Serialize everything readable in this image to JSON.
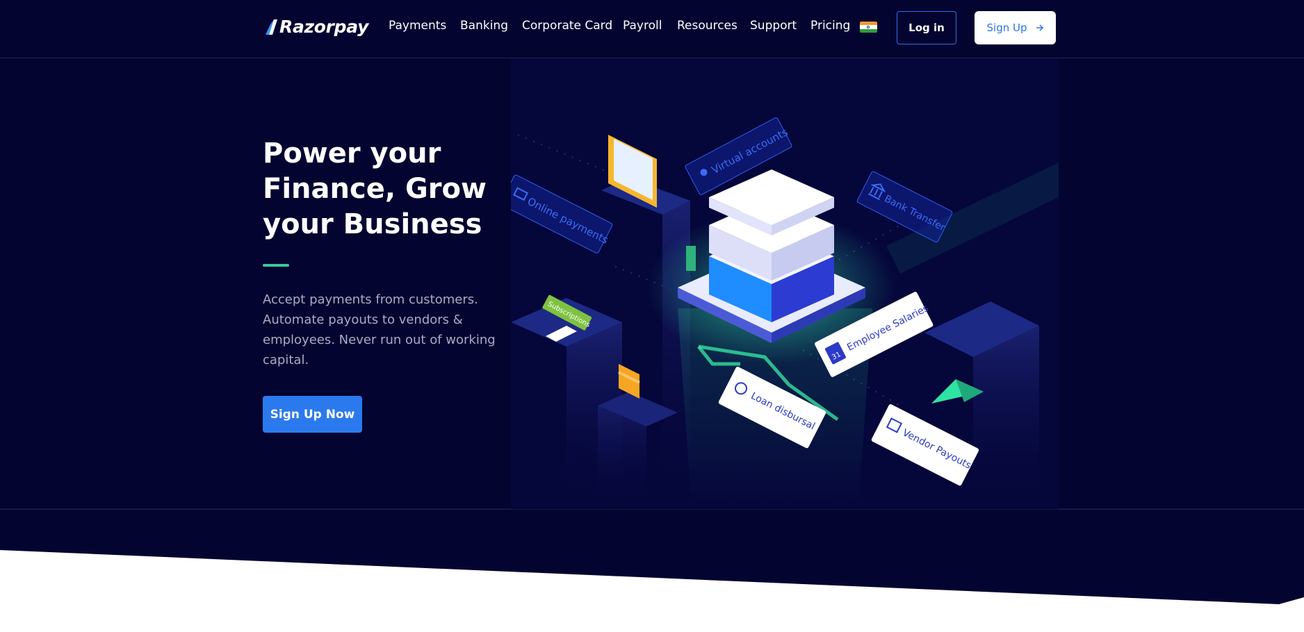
{
  "brand": {
    "name": "Razorpay"
  },
  "nav": {
    "items": [
      {
        "label": "Payments"
      },
      {
        "label": "Banking"
      },
      {
        "label": "Corporate Card"
      },
      {
        "label": "Payroll"
      },
      {
        "label": "Resources"
      },
      {
        "label": "Support"
      },
      {
        "label": "Pricing"
      }
    ],
    "country_flag": "india-flag-icon",
    "login_label": "Log in",
    "signup_label": "Sign Up",
    "signup_icon": "arrow-right-icon"
  },
  "hero": {
    "title": "Power your Finance, Grow your Business",
    "description": "Accept payments from customers. Automate payouts to vendors & employees. Never run out of working capital.",
    "cta_label": "Sign Up Now"
  },
  "illustration": {
    "labels": {
      "virtual_accounts": "Virtual accounts",
      "online_payments": "Online payments",
      "bank_transfer": "Bank Transfer",
      "subscriptions": "Subscriptions",
      "employee_salaries": "Employee Salaries",
      "loan_disbursal": "Loan disbursal",
      "vendor_payouts": "Vendor Payouts",
      "calendar_day": "31"
    }
  },
  "colors": {
    "background": "#030430",
    "accent_green": "#3ac99b",
    "primary_blue": "#2b7aed",
    "text_muted": "#a7acc4"
  }
}
